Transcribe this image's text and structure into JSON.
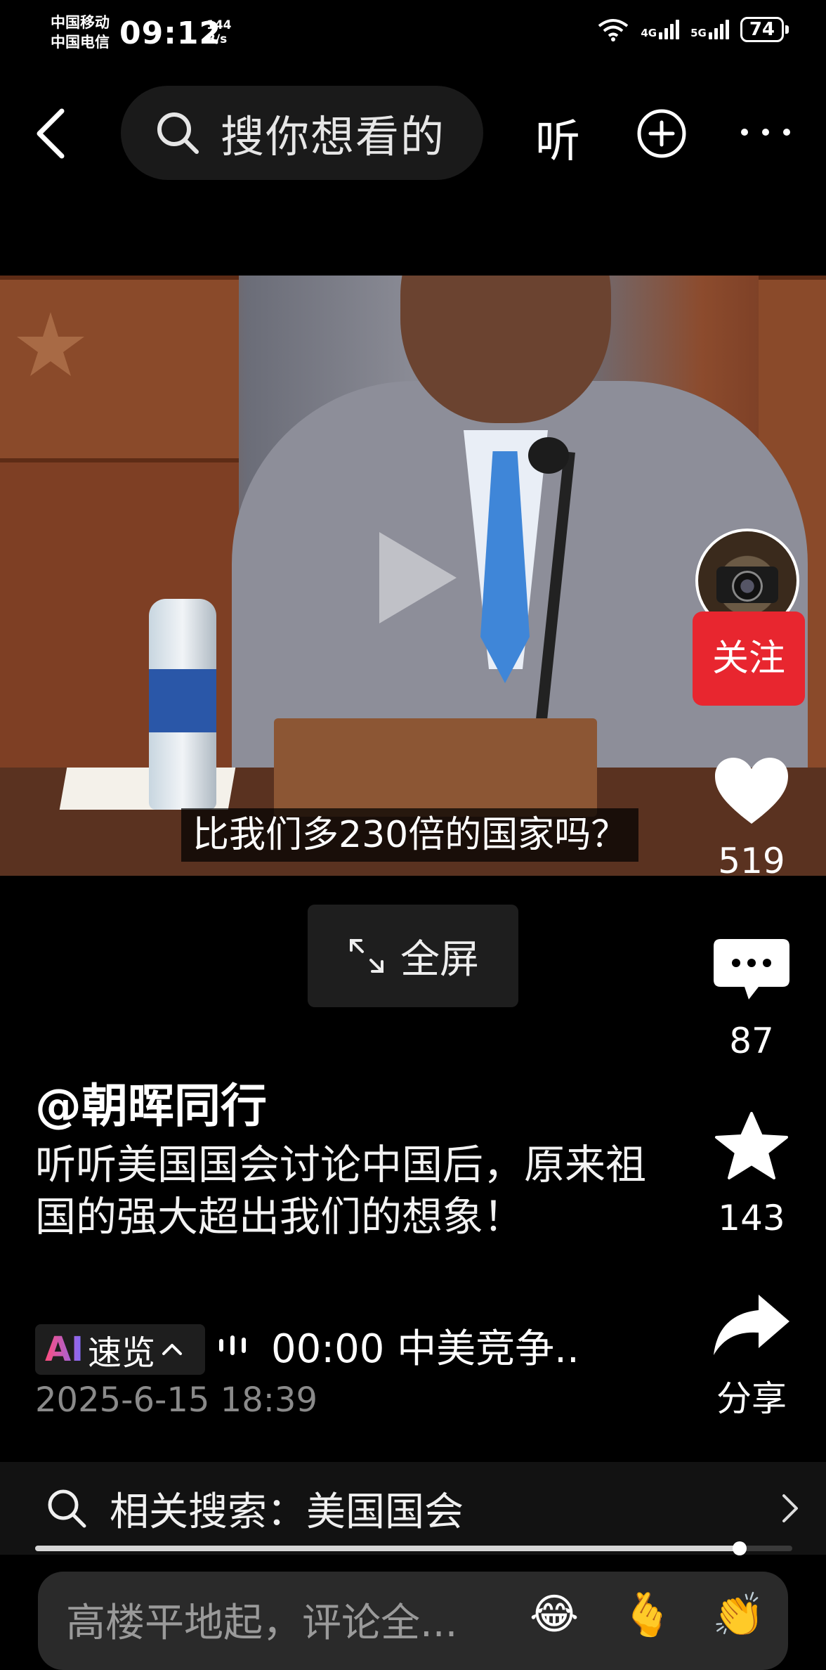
{
  "status_bar": {
    "carrier1": "中国移动",
    "carrier2": "中国电信",
    "time": "09:12",
    "netspeed_value": "144",
    "netspeed_unit": "B/s",
    "sim1_label": "4G",
    "sim2_label": "5G",
    "battery": "74"
  },
  "nav": {
    "search_placeholder": "搜你想看的",
    "listen_label": "听"
  },
  "video": {
    "subtitle": "比我们多230倍的国家吗？"
  },
  "side": {
    "follow_label": "关注",
    "likes": "519",
    "comments": "87",
    "favorites": "143",
    "share_label": "分享"
  },
  "fullscreen_label": "全屏",
  "caption": {
    "author": "@朝晖同行",
    "description": "听听美国国会讨论中国后，原来祖国的强大超出我们的想象！",
    "ai_badge": "AI",
    "ai_label": "速览",
    "ai_chevron": "^",
    "ai_summary": "00:00 中美竞争..",
    "date": "2025-6-15 18:39"
  },
  "related": {
    "label": "相关搜索：美国国会"
  },
  "progress": {
    "fraction": 0.93
  },
  "comment": {
    "placeholder": "高楼平地起，评论全...",
    "emojis": [
      "😂",
      "🫰",
      "👏"
    ]
  }
}
